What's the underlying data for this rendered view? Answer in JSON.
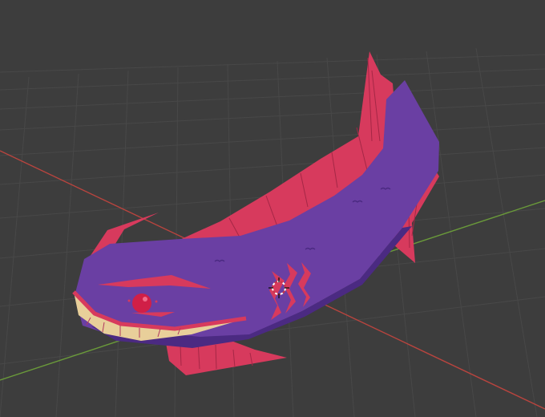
{
  "viewport": {
    "background": "#3d3d3d",
    "grid_color": "#484848",
    "x_axis_color": "#b8443e",
    "y_axis_color": "#6a9a3a"
  },
  "model": {
    "body_color": "#6a3fa3",
    "body_shadow_color": "#4b2a82",
    "fin_color": "#d73a5d",
    "fin_line_color": "#a52746",
    "mouth_color": "#e8cf9a",
    "eye_color": "#d01f47"
  },
  "icons": {
    "cursor": "3d-cursor-icon"
  }
}
